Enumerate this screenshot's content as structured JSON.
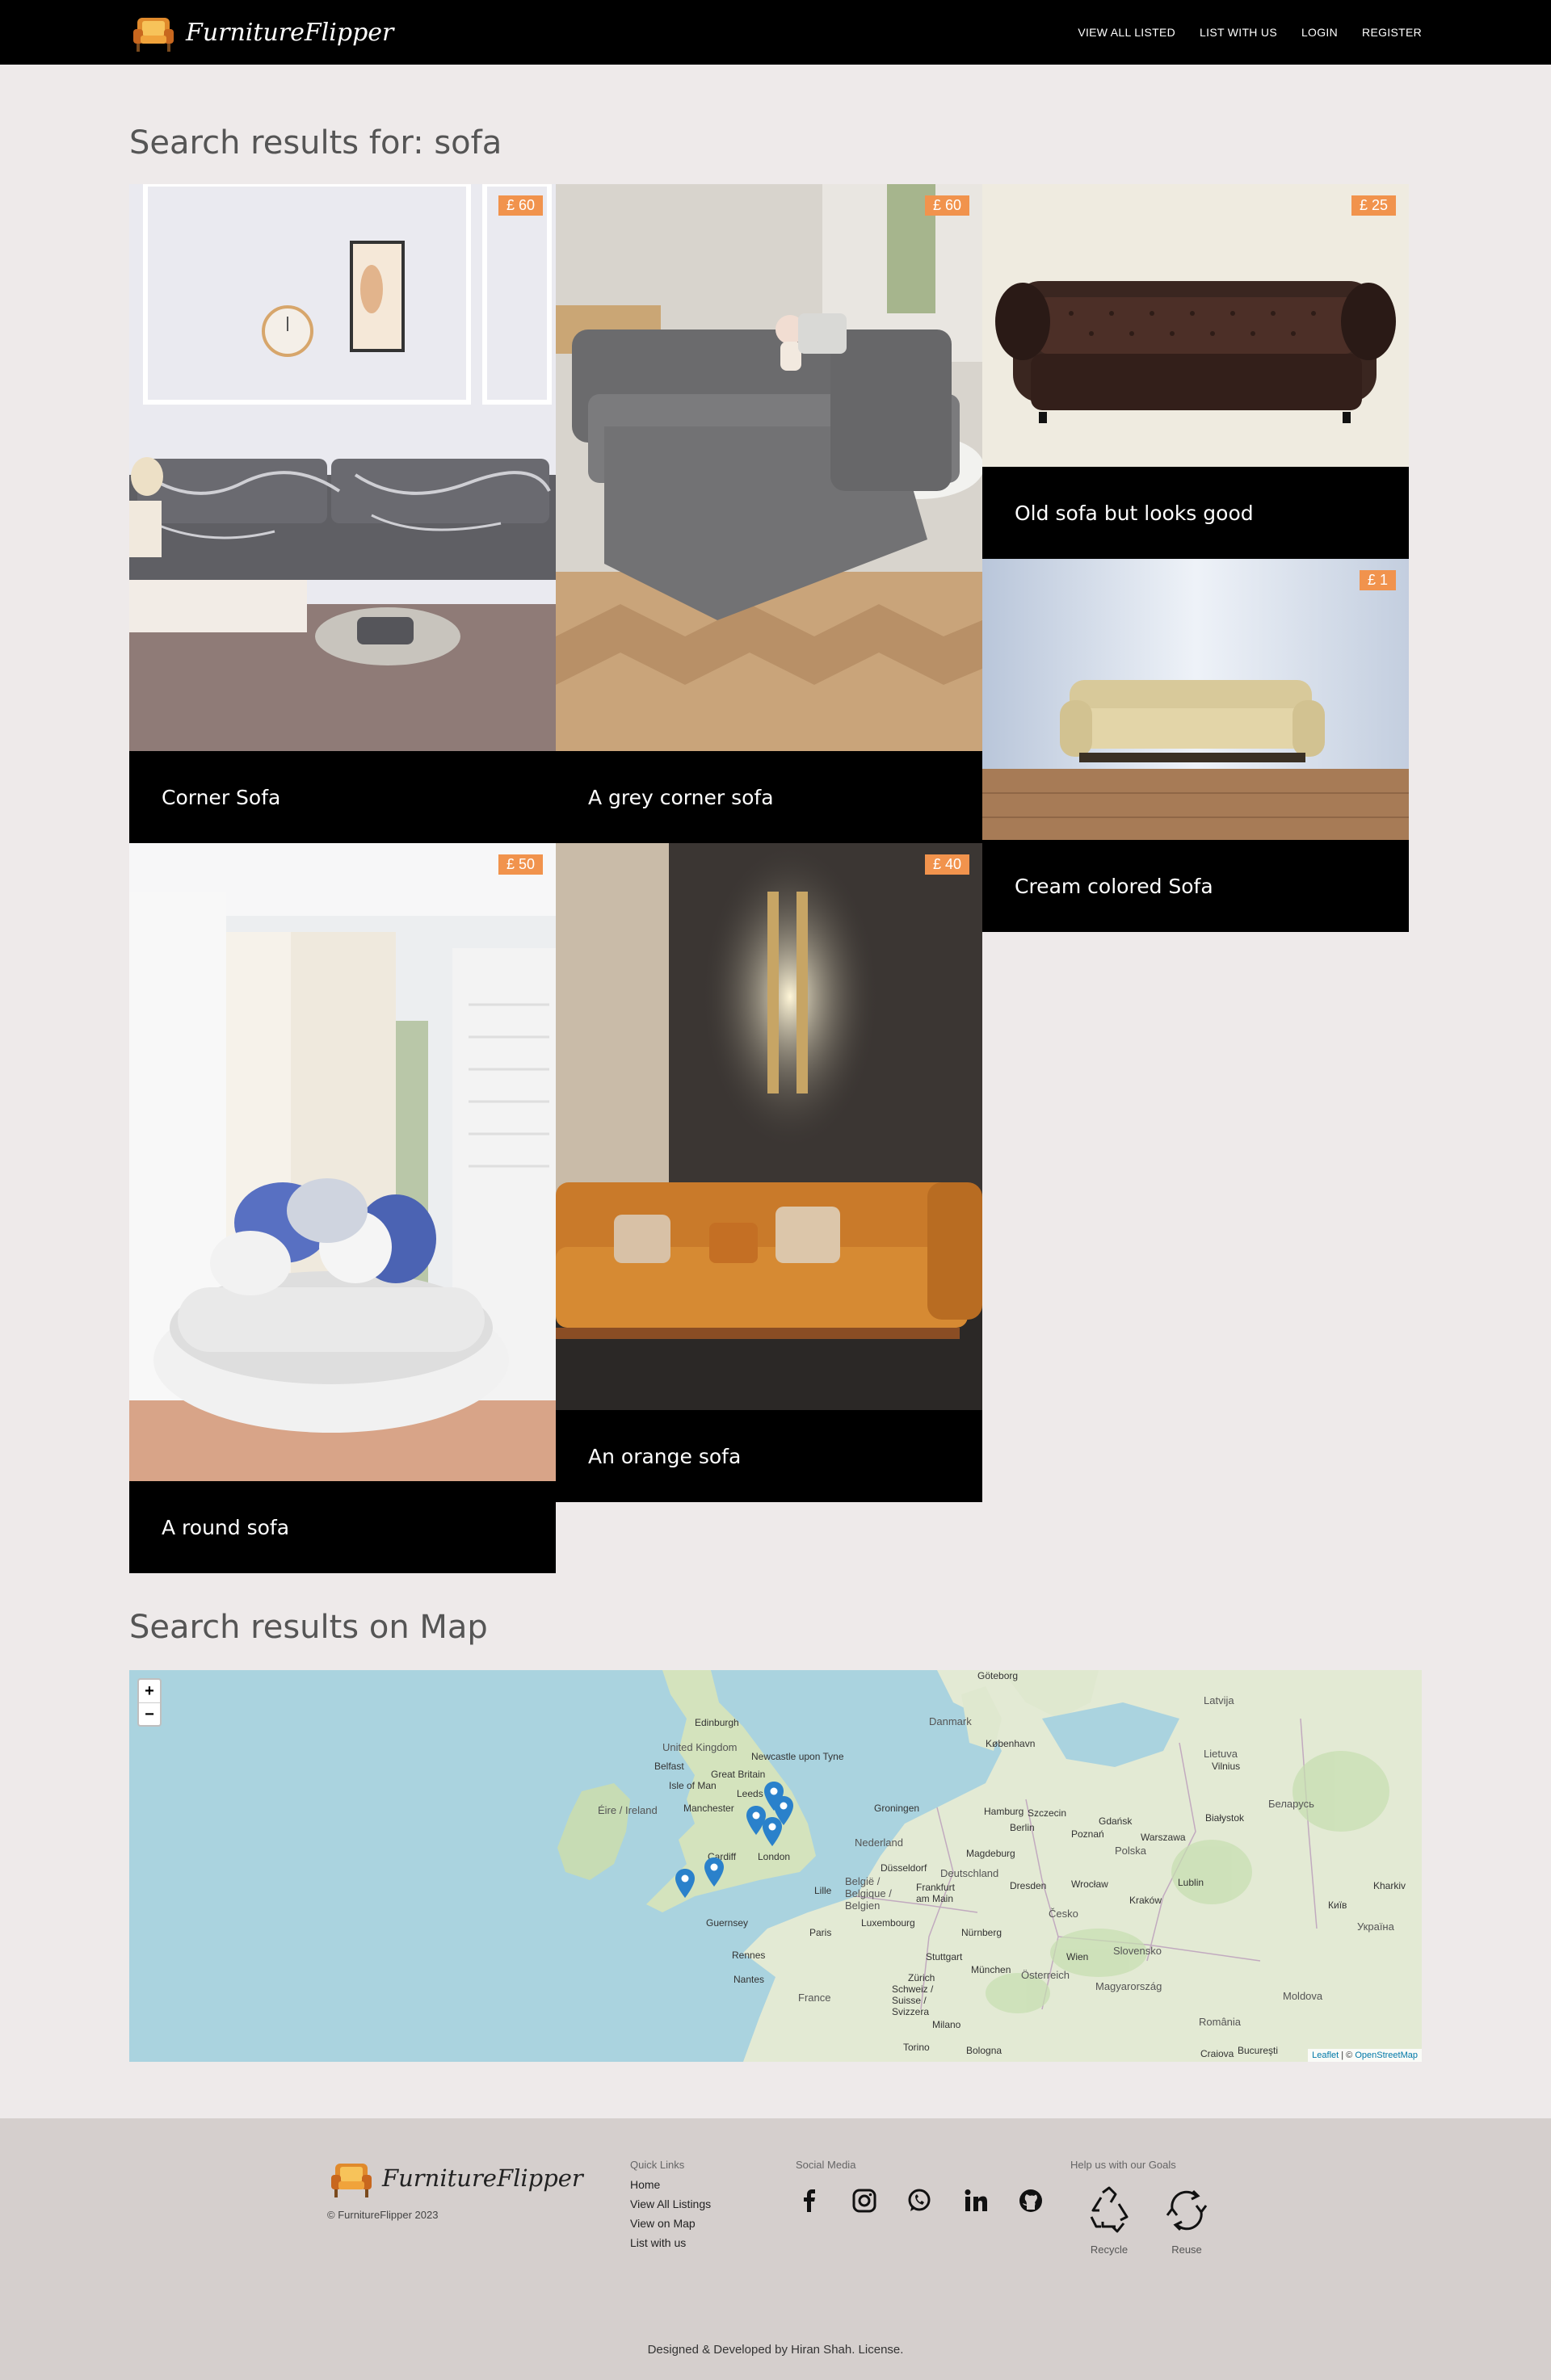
{
  "nav": {
    "brand": "FurnitureFlipper",
    "links": [
      "VIEW ALL LISTED",
      "LIST WITH US",
      "LOGIN",
      "REGISTER"
    ]
  },
  "search": {
    "title": "Search results for: sofa",
    "results": [
      {
        "title": "Corner Sofa",
        "price": "£ 60"
      },
      {
        "title": "A grey corner sofa",
        "price": "£ 60"
      },
      {
        "title": "Old sofa but looks good",
        "price": "£ 25"
      },
      {
        "title": "Cream colored Sofa",
        "price": "£ 1"
      },
      {
        "title": "A round sofa",
        "price": "£ 50"
      },
      {
        "title": "An orange sofa",
        "price": "£ 40"
      }
    ]
  },
  "map": {
    "title": "Search results on Map",
    "zoom_in": "+",
    "zoom_out": "−",
    "attribution_leaflet": "Leaflet",
    "attribution_sep": " | © ",
    "attribution_osm": "OpenStreetMap",
    "labels": [
      "Göteborg",
      "Edinburgh",
      "Danmark",
      "København",
      "Latvija",
      "Lietuva",
      "Vilnius",
      "United Kingdom",
      "Newcastle upon Tyne",
      "Belfast",
      "Isle of Man",
      "Great Britain",
      "Leeds",
      "Manchester",
      "Éire / Ireland",
      "Hamburg",
      "Groningen",
      "Szczecin",
      "Gdańsk",
      "Białystok",
      "Беларусь",
      "Nederland",
      "Berlin",
      "Poznań",
      "Warszawa",
      "Polska",
      "London",
      "Cardiff",
      "Deutschland",
      "Magdeburg",
      "Dresden",
      "Wrocław",
      "Lublin",
      "Düsseldorf",
      "België / Belgique / Belgien",
      "Frankfurt am Main",
      "Luxembourg",
      "Česko",
      "Kraków",
      "Lille",
      "Guernsey",
      "Paris",
      "Nürnberg",
      "Stuttgart",
      "Rennes",
      "Nantes",
      "München",
      "Wien",
      "Slovensko",
      "France",
      "Österreich",
      "Magyarország",
      "Schweiz / Suisse / Svizzera",
      "Zürich",
      "Milano",
      "Torino",
      "România",
      "Moldova",
      "Київ",
      "Україна",
      "Bologna",
      "Bucureşti",
      "Craiova",
      "Kharkiv"
    ]
  },
  "footer": {
    "brand": "FurnitureFlipper",
    "copyright": "© FurnitureFlipper 2023",
    "quick_links_title": "Quick Links",
    "quick_links": [
      "Home",
      "View All Listings",
      "View on Map",
      "List with us"
    ],
    "social_title": "Social Media",
    "goals_title": "Help us with our Goals",
    "goals": [
      "Recycle",
      "Reuse"
    ],
    "credit": "Designed & Developed by Hiran Shah. License."
  },
  "colors": {
    "nav_bg": "#000000",
    "page_bg": "#eeeaea",
    "price_badge": "#f1934d",
    "footer_bg": "#d5cfcd",
    "map_water": "#aad3df",
    "marker": "#2a81cb"
  },
  "icons": [
    "armchair-logo-icon",
    "facebook-icon",
    "instagram-icon",
    "whatsapp-icon",
    "linkedin-icon",
    "github-icon",
    "recycle-icon",
    "reuse-icon",
    "map-marker-icon"
  ]
}
